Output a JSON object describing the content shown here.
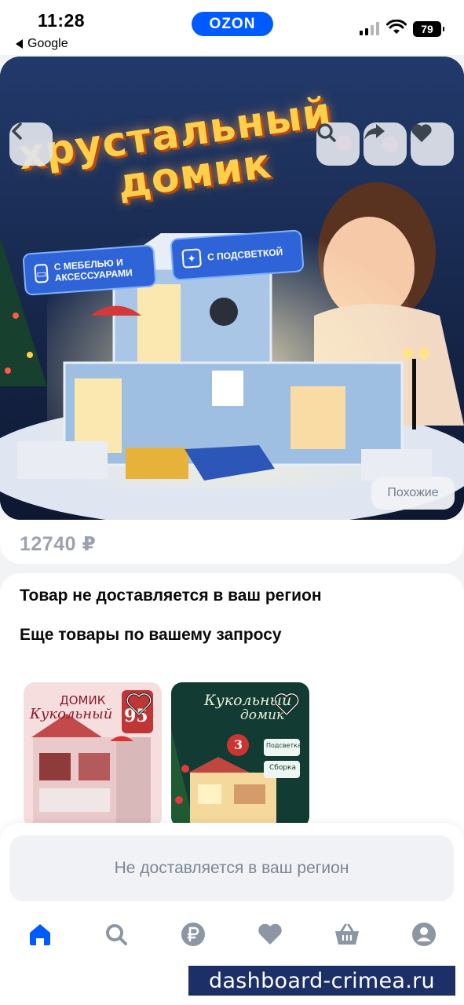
{
  "status_bar": {
    "time": "11:28",
    "back_app": "Google",
    "brand": "OZON",
    "battery": "79"
  },
  "product": {
    "image_title_line1": "хрустальный",
    "image_title_line2": "домик",
    "badge_furniture": "с мебелью и аксессуарами",
    "badge_light": "с подсветкой",
    "similar_button": "Похожие",
    "price": "12740 ₽"
  },
  "info": {
    "not_delivered_text": "Товар не доставляется в ваш регион",
    "more_products_heading": "Еще товары по вашему запросу"
  },
  "recommendations": [
    {
      "image_text_1": "ДОМИК",
      "image_text_2": "Кукольный",
      "image_text_3": "95"
    },
    {
      "image_text_1": "Кукольный",
      "image_text_2": "домик",
      "image_text_3": "3",
      "image_text_4": "Подсветка",
      "image_text_5": "Сборка"
    }
  ],
  "cta": {
    "button_label": "Не доставляется в ваш регион"
  },
  "tabbar": {
    "items": [
      {
        "icon": "home-icon",
        "active": true
      },
      {
        "icon": "search-icon",
        "active": false
      },
      {
        "icon": "ruble-icon",
        "active": false
      },
      {
        "icon": "heart-icon",
        "active": false
      },
      {
        "icon": "basket-icon",
        "active": false
      },
      {
        "icon": "profile-icon",
        "active": false
      }
    ]
  },
  "watermark": "dashboard-crimea.ru",
  "colors": {
    "brand_blue": "#005bff",
    "active_tab": "#005bff",
    "inactive_tab": "#8c97a3"
  }
}
